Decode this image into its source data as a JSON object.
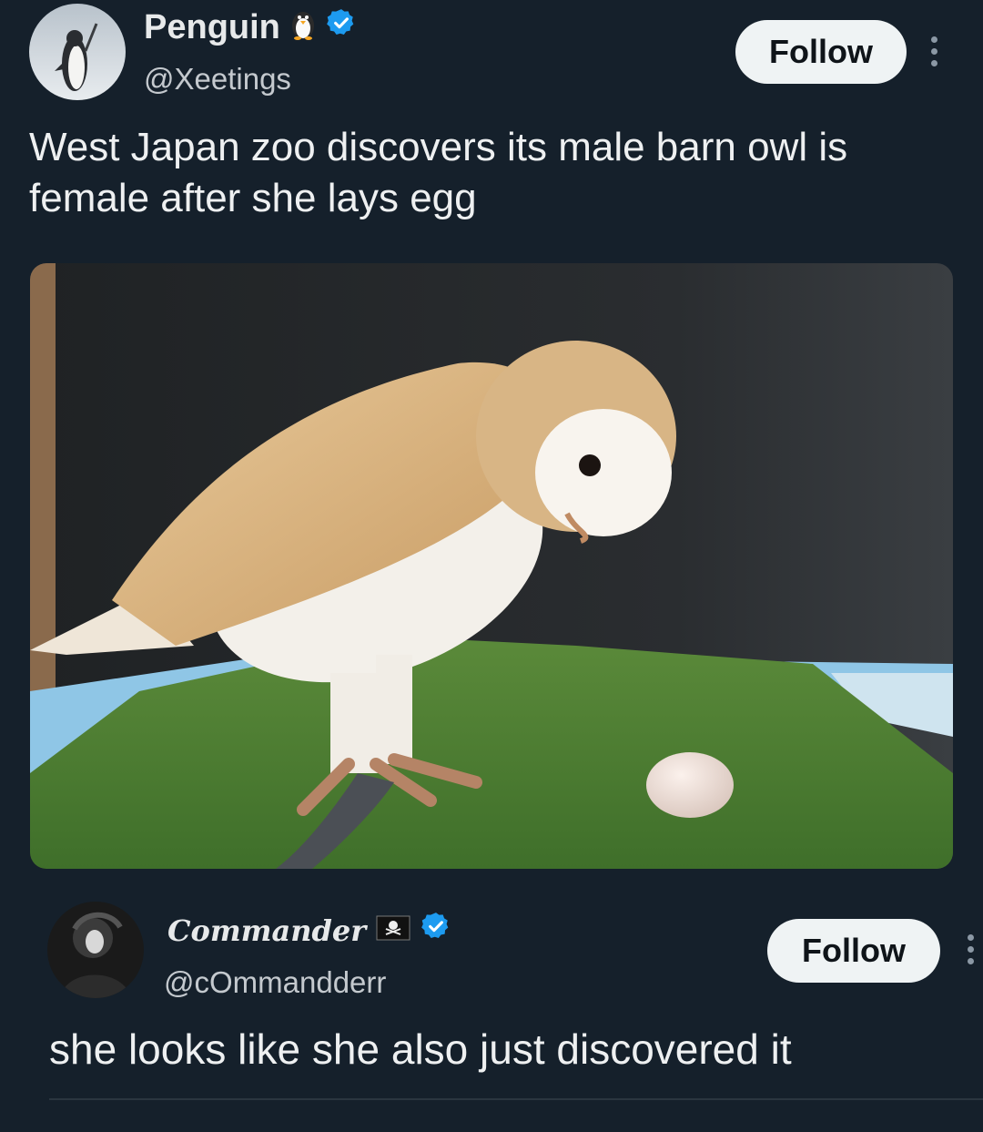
{
  "post": {
    "author": {
      "name": "Penguin",
      "handle": "@Xeetings",
      "emoji": "penguin-emoji",
      "verified": true
    },
    "follow_label": "Follow",
    "text": "West Japan zoo discovers its male barn owl is female after she lays egg",
    "media": {
      "subject": "barn owl looking down at an egg on artificial grass"
    }
  },
  "reply": {
    "author": {
      "name": "Commander",
      "handle": "@cOmmandderr",
      "emoji": "pirate-flag-emoji",
      "verified": true
    },
    "follow_label": "Follow",
    "text": "she looks like she also just discovered it"
  },
  "colors": {
    "background": "#15202b",
    "verified": "#1d9bf0",
    "follow_button": "#eff3f4"
  }
}
